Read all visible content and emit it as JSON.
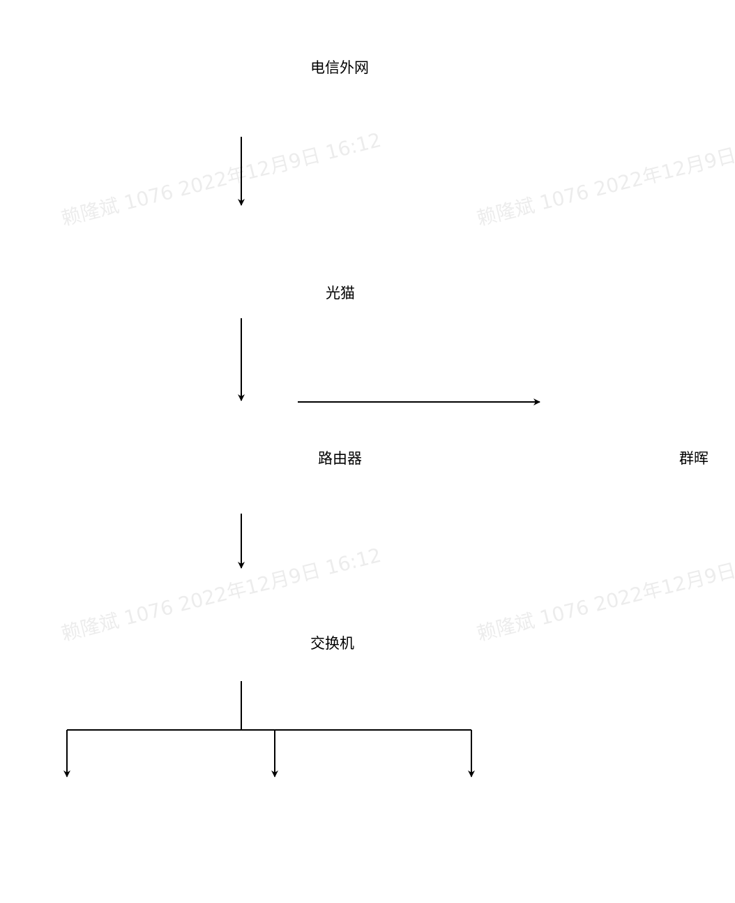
{
  "nodes": {
    "internet": "电信外网",
    "modem": "光猫",
    "router": "路由器",
    "nas": "群晖",
    "switch": "交换机"
  },
  "watermark_text": "赖隆斌 1076 2022年12月9日 16:12",
  "colors": {
    "line": "#000000",
    "text": "#000000",
    "background": "#ffffff"
  }
}
